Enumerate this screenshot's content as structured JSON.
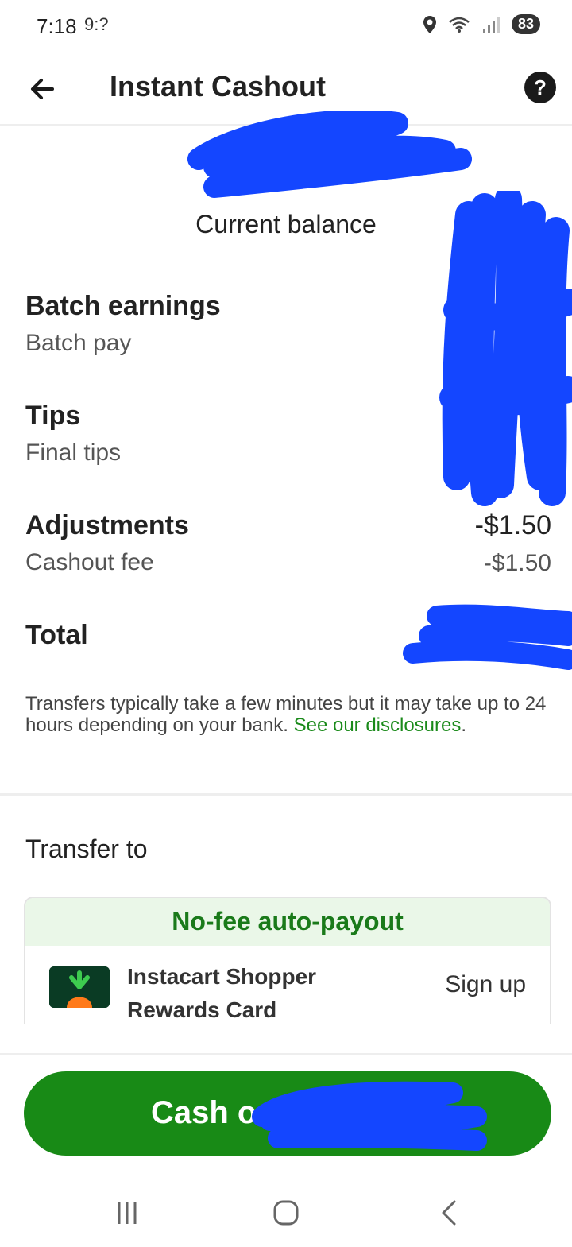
{
  "status_bar": {
    "time": "7:18",
    "extra": "9:?",
    "battery": "83"
  },
  "header": {
    "title": "Instant Cashout",
    "help": "?"
  },
  "balance": {
    "label": "Current balance"
  },
  "rows": [
    {
      "title": "Batch earnings",
      "subtitle": "Batch pay",
      "value": "",
      "sub_value": ""
    },
    {
      "title": "Tips",
      "subtitle": "Final tips",
      "value": "",
      "sub_value": ""
    },
    {
      "title": "Adjustments",
      "subtitle": "Cashout fee",
      "value": "-$1.50",
      "sub_value": "-$1.50"
    }
  ],
  "total": {
    "label": "Total"
  },
  "disclaimer": {
    "text": "Transfers typically take a few minutes but it may take up to 24 hours depending on your bank. ",
    "link": "See our disclosures",
    "end": "."
  },
  "transfer": {
    "label": "Transfer to"
  },
  "payout": {
    "banner": "No-fee auto-payout",
    "card_line1": "Instacart Shopper",
    "card_line2": "Rewards Card",
    "signup": "Sign up"
  },
  "cash_button": {
    "label": "Cash o"
  },
  "colors": {
    "accent": "#188a16",
    "link": "#1a8a1a",
    "banner_bg": "#eaf7e8",
    "redaction": "#1446ff"
  }
}
